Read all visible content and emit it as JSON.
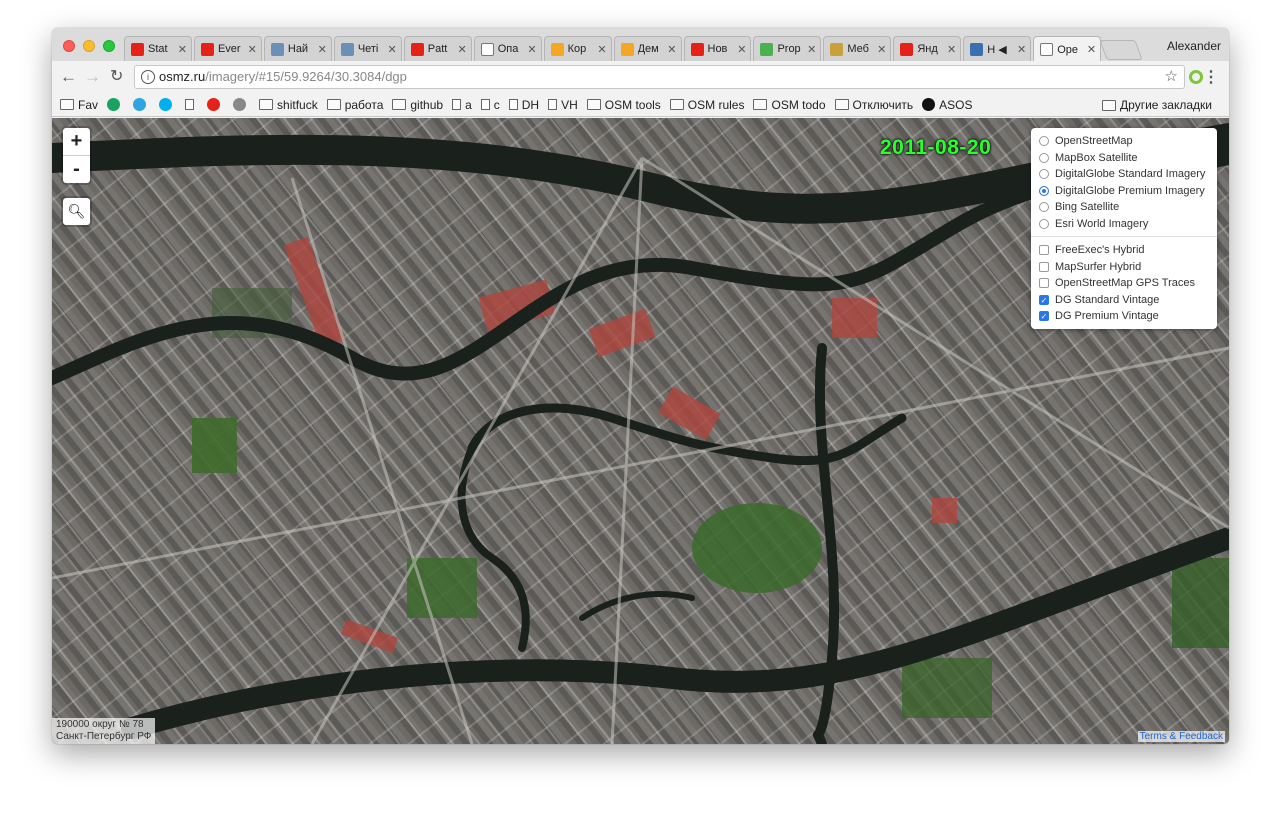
{
  "tabs": [
    {
      "title": "Stat",
      "favicon": "youtube-icon",
      "color": "#e62117"
    },
    {
      "title": "Ever",
      "favicon": "youtube-icon",
      "color": "#e62117"
    },
    {
      "title": "Най",
      "favicon": "hh-icon",
      "color": "#6b8fb7"
    },
    {
      "title": "Четі",
      "favicon": "hh-icon",
      "color": "#6b8fb7"
    },
    {
      "title": "Patt",
      "favicon": "oval-icon",
      "color": "#e62117"
    },
    {
      "title": "Опа",
      "favicon": "page-icon",
      "color": "#ffffff"
    },
    {
      "title": "Кор",
      "favicon": "cat-icon",
      "color": "#f5a623"
    },
    {
      "title": "Дем",
      "favicon": "cat-icon",
      "color": "#f5a623"
    },
    {
      "title": "Нов",
      "favicon": "tv-icon",
      "color": "#e62117"
    },
    {
      "title": "Prop",
      "favicon": "tool-icon",
      "color": "#4caf50"
    },
    {
      "title": "Меб",
      "favicon": "sofa-icon",
      "color": "#c9a13b"
    },
    {
      "title": "Янд",
      "favicon": "pin-icon",
      "color": "#e62117"
    },
    {
      "title": "Н ◀ᅠ",
      "favicon": "play-icon",
      "color": "#3a6fb0"
    },
    {
      "title": "Ope",
      "favicon": "page-icon",
      "color": "#ffffff",
      "active": true
    }
  ],
  "profile": "Alexander",
  "address": {
    "host": "osmz.ru",
    "path": "/imagery/#15/59.9264/30.3084/dgp"
  },
  "bookmarks": [
    {
      "label": "Fav",
      "icon": "folder-icon"
    },
    {
      "label": "",
      "icon": "badge-icon"
    },
    {
      "label": "",
      "icon": "telegram-icon"
    },
    {
      "label": "",
      "icon": "skype-icon"
    },
    {
      "label": "",
      "icon": "page-icon"
    },
    {
      "label": "",
      "icon": "youtube-icon"
    },
    {
      "label": "",
      "icon": "robot-icon"
    },
    {
      "label": "shitfuck",
      "icon": "folder-icon"
    },
    {
      "label": "работа",
      "icon": "folder-icon"
    },
    {
      "label": "github",
      "icon": "folder-icon"
    },
    {
      "label": "a",
      "icon": "page-icon"
    },
    {
      "label": "c",
      "icon": "page-icon"
    },
    {
      "label": "DH",
      "icon": "page-icon"
    },
    {
      "label": "VH",
      "icon": "page-icon"
    },
    {
      "label": "OSM tools",
      "icon": "folder-icon"
    },
    {
      "label": "OSM rules",
      "icon": "folder-icon"
    },
    {
      "label": "OSM todo",
      "icon": "folder-icon"
    },
    {
      "label": "Отключить",
      "icon": "folder-icon"
    },
    {
      "label": "ASOS",
      "icon": "asos-icon"
    }
  ],
  "other_bookmarks": "Другие закладки",
  "map": {
    "zoom_in": "+",
    "zoom_out": "-",
    "date": "2011-08-20",
    "base_layers": [
      {
        "label": "OpenStreetMap",
        "selected": false
      },
      {
        "label": "MapBox Satellite",
        "selected": false
      },
      {
        "label": "DigitalGlobe Standard Imagery",
        "selected": false
      },
      {
        "label": "DigitalGlobe Premium Imagery",
        "selected": true
      },
      {
        "label": "Bing Satellite",
        "selected": false
      },
      {
        "label": "Esri World Imagery",
        "selected": false
      }
    ],
    "overlays": [
      {
        "label": "FreeExec's Hybrid",
        "checked": false
      },
      {
        "label": "MapSurfer Hybrid",
        "checked": false
      },
      {
        "label": "OpenStreetMap GPS Traces",
        "checked": false
      },
      {
        "label": "DG Standard Vintage",
        "checked": true
      },
      {
        "label": "DG Premium Vintage",
        "checked": true
      }
    ],
    "postal_line1": "190000 округ № 78",
    "postal_line2": "Санкт-Петербург РФ",
    "terms": "Terms & Feedback"
  },
  "colors": {
    "accent": "#2a78e4",
    "date_green": "#2bff2b",
    "water": "#1c2420",
    "park": "#3e6b2c",
    "roof_red": "#b04a45"
  }
}
